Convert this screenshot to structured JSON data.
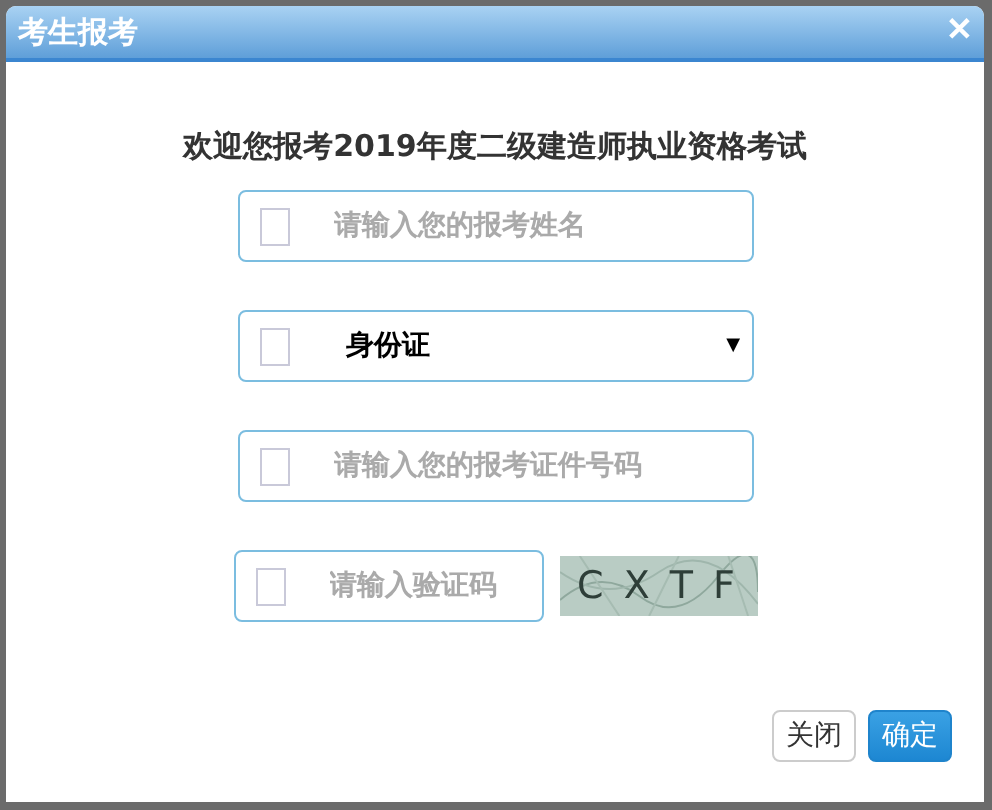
{
  "window": {
    "title": "考生报考",
    "close": "✕"
  },
  "heading": "欢迎您报考2019年度二级建造师执业资格考试",
  "fields": [
    {
      "kind": "input",
      "placeholder": "请输入您的报考姓名"
    },
    {
      "kind": "select",
      "value": "身份证",
      "arrow": "▼"
    },
    {
      "kind": "input",
      "placeholder": "请输入您的报考证件号码"
    },
    {
      "kind": "captcha",
      "placeholder": "请输入验证码",
      "captcha": "C X T F"
    }
  ],
  "buttons": [
    {
      "label": "关闭",
      "primary": false
    },
    {
      "label": "确定",
      "primary": true
    }
  ]
}
